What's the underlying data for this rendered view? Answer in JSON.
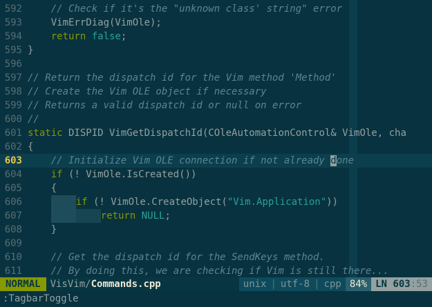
{
  "editor": {
    "lines": [
      {
        "n": "592",
        "segs": [
          [
            "c",
            "    // Check if it's the \"unknown class' string\" error"
          ]
        ]
      },
      {
        "n": "593",
        "segs": [
          [
            "p",
            "    VimErrDiag(VimOle);"
          ]
        ]
      },
      {
        "n": "594",
        "segs": [
          [
            "p",
            "    "
          ],
          [
            "k",
            "return"
          ],
          [
            "p",
            " "
          ],
          [
            "s",
            "false"
          ],
          [
            "p",
            ";"
          ]
        ]
      },
      {
        "n": "595",
        "segs": [
          [
            "p",
            "}"
          ]
        ]
      },
      {
        "n": "596",
        "segs": []
      },
      {
        "n": "597",
        "segs": [
          [
            "c",
            "// Return the dispatch id for the Vim method 'Method'"
          ]
        ]
      },
      {
        "n": "598",
        "segs": [
          [
            "c",
            "// Create the Vim OLE object if necessary"
          ]
        ]
      },
      {
        "n": "599",
        "segs": [
          [
            "c",
            "// Returns a valid dispatch id or null on error"
          ]
        ]
      },
      {
        "n": "600",
        "segs": [
          [
            "c",
            "//"
          ]
        ]
      },
      {
        "n": "601",
        "segs": [
          [
            "k",
            "static"
          ],
          [
            "p",
            " DISPID VimGetDispatchId(COleAutomationControl& VimOle, cha"
          ]
        ]
      },
      {
        "n": "602",
        "segs": [
          [
            "p",
            "{"
          ]
        ]
      },
      {
        "n": "603",
        "cur": true,
        "segs": [
          [
            "c",
            "    // Initialize Vim OLE connection if not already "
          ],
          [
            "cur",
            "d"
          ],
          [
            "c",
            "one"
          ]
        ]
      },
      {
        "n": "604",
        "segs": [
          [
            "p",
            "    "
          ],
          [
            "k",
            "if"
          ],
          [
            "p",
            " (! VimOle.IsCreated())"
          ]
        ]
      },
      {
        "n": "605",
        "segs": [
          [
            "p",
            "    {"
          ]
        ]
      },
      {
        "n": "606",
        "segs": [
          [
            "p",
            "    "
          ],
          [
            "ws",
            "    "
          ],
          [
            "k",
            "if"
          ],
          [
            "p",
            " (! VimOle.CreateObject("
          ],
          [
            "s",
            "\"Vim.Application\""
          ],
          [
            "p",
            "))"
          ]
        ]
      },
      {
        "n": "607",
        "segs": [
          [
            "p",
            "    "
          ],
          [
            "ws",
            "    "
          ],
          [
            "ws2",
            "    "
          ],
          [
            "k",
            "return"
          ],
          [
            "p",
            " "
          ],
          [
            "s",
            "NULL"
          ],
          [
            "p",
            ";"
          ]
        ]
      },
      {
        "n": "608",
        "segs": [
          [
            "p",
            "    }"
          ]
        ]
      },
      {
        "n": "609",
        "segs": []
      },
      {
        "n": "610",
        "segs": [
          [
            "c",
            "    // Get the dispatch id for the SendKeys method."
          ]
        ]
      },
      {
        "n": "611",
        "segs": [
          [
            "c",
            "    // By doing this, we are checking if Vim is still there..."
          ]
        ]
      }
    ]
  },
  "statusline": {
    "mode": "NORMAL",
    "path_prefix": "VisVim/",
    "filename": "Commands.cpp",
    "fileformat": "unix",
    "encoding": "utf-8",
    "filetype": "cpp",
    "sep": "|",
    "percent": "84%",
    "ln_label": "LN",
    "line": "603",
    "col": ":53"
  },
  "cmdline": {
    "text": ":TagbarToggle"
  }
}
